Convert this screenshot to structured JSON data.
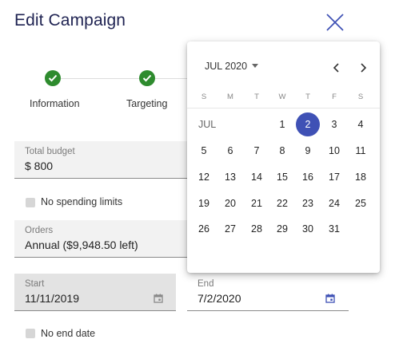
{
  "page": {
    "title": "Edit Campaign"
  },
  "icons": {
    "close": "close-icon",
    "calendar": "calendar-icon",
    "check": "check-icon"
  },
  "colors": {
    "accent": "#3f51b5",
    "step_done": "#2e8b2e",
    "title": "#1f2352"
  },
  "stepper": {
    "steps": [
      {
        "label": "Information",
        "status": "done"
      },
      {
        "label": "Targeting",
        "status": "done"
      }
    ]
  },
  "form": {
    "total_budget": {
      "label": "Total budget",
      "value": "$ 800"
    },
    "no_spending_limits": {
      "label": "No spending limits",
      "checked": false
    },
    "orders": {
      "label": "Orders",
      "value": "Annual ($9,948.50 left)"
    },
    "start": {
      "label": "Start",
      "value": "11/11/2019"
    },
    "end": {
      "label": "End",
      "value": "7/2/2020"
    },
    "no_end_date": {
      "label": "No end date",
      "checked": false
    }
  },
  "calendar": {
    "month_year": "JUL 2020",
    "month_tag": "JUL",
    "weekdays": [
      "S",
      "M",
      "T",
      "W",
      "T",
      "F",
      "S"
    ],
    "selected_day": "2",
    "weeks": [
      [
        "",
        "",
        "",
        "1",
        "2",
        "3",
        "4"
      ],
      [
        "5",
        "6",
        "7",
        "8",
        "9",
        "10",
        "11"
      ],
      [
        "12",
        "13",
        "14",
        "15",
        "16",
        "17",
        "18"
      ],
      [
        "19",
        "20",
        "21",
        "22",
        "23",
        "24",
        "25"
      ],
      [
        "26",
        "27",
        "28",
        "29",
        "30",
        "31",
        ""
      ]
    ]
  }
}
